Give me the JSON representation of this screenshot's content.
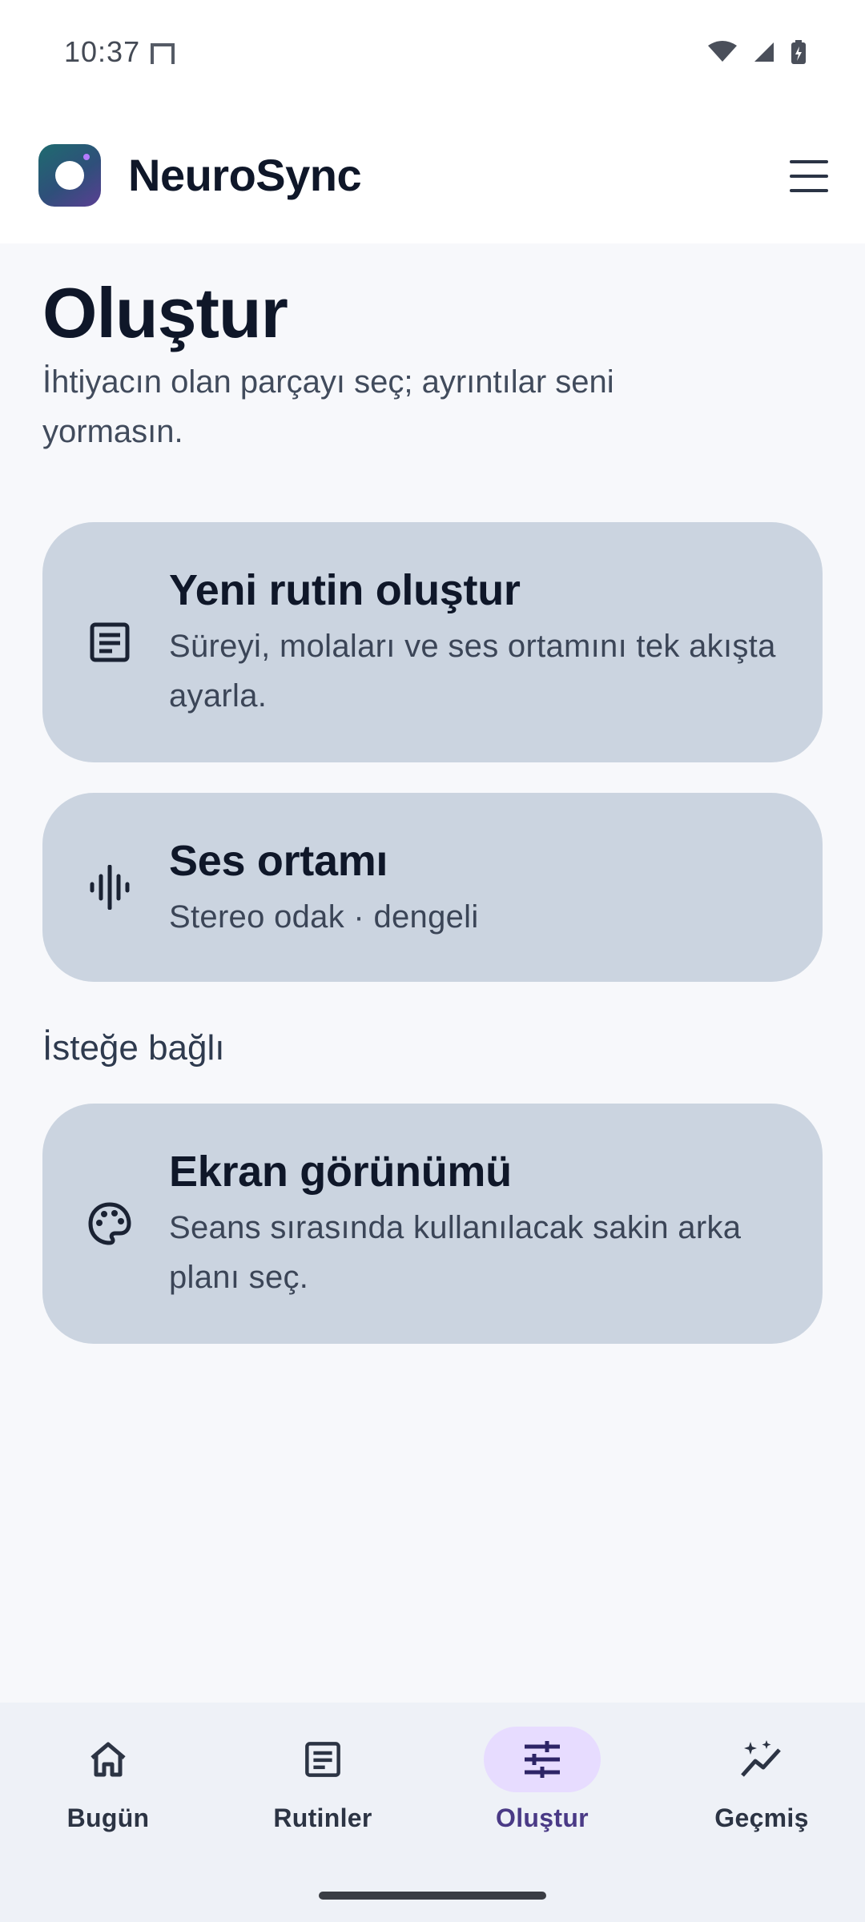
{
  "status_bar": {
    "time": "10:37"
  },
  "header": {
    "app_name": "NeuroSync"
  },
  "page": {
    "title": "Oluştur",
    "subtitle": "İhtiyacın olan parçayı seç; ayrıntılar seni yormasın."
  },
  "cards": [
    {
      "icon": "document-icon",
      "title": "Yeni rutin oluştur",
      "description": "Süreyi, molaları ve ses ortamını tek akışta ayarla."
    },
    {
      "icon": "audio-wave-icon",
      "title": "Ses ortamı",
      "description": "Stereo odak · dengeli"
    }
  ],
  "optional": {
    "label": "İsteğe bağlı",
    "cards": [
      {
        "icon": "palette-icon",
        "title": "Ekran görünümü",
        "description": "Seans sırasında kullanılacak sakin arka planı seç."
      }
    ]
  },
  "bottom_nav": {
    "items": [
      {
        "label": "Bugün",
        "icon": "home-icon",
        "active": false
      },
      {
        "label": "Rutinler",
        "icon": "document-icon",
        "active": false
      },
      {
        "label": "Oluştur",
        "icon": "sliders-icon",
        "active": true
      },
      {
        "label": "Geçmiş",
        "icon": "sparkle-chart-icon",
        "active": false
      }
    ]
  },
  "colors": {
    "card_background": "#cbd4e0",
    "accent_pill": "#e7dcff",
    "accent_text": "#4a3a86"
  }
}
